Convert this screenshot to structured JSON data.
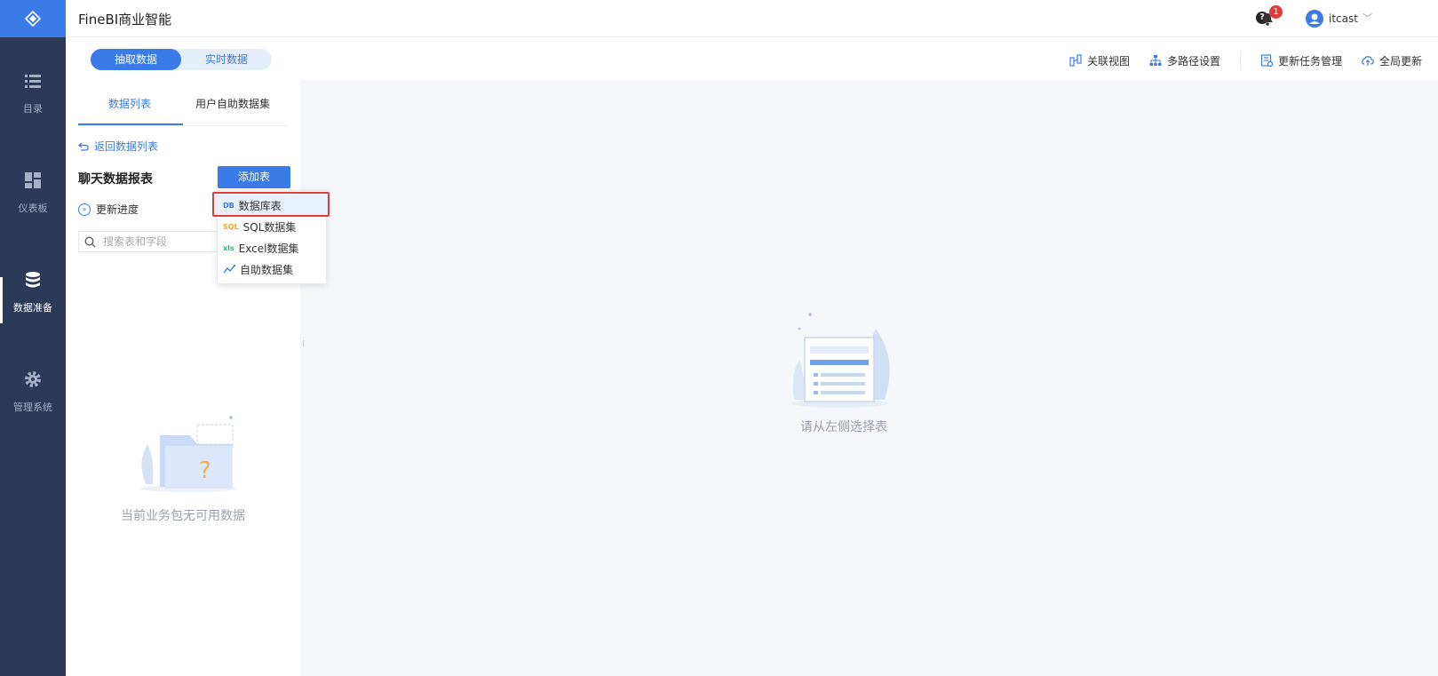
{
  "app": {
    "title": "FineBI商业智能"
  },
  "user": {
    "name": "itcast",
    "notifications": "1"
  },
  "nav": {
    "items": [
      {
        "label": "目录",
        "icon": "list-icon"
      },
      {
        "label": "仪表板",
        "icon": "dashboard-icon"
      },
      {
        "label": "数据准备",
        "icon": "database-icon",
        "active": true
      },
      {
        "label": "管理系统",
        "icon": "gear-icon"
      }
    ]
  },
  "mode": {
    "extract": "抽取数据",
    "realtime": "实时数据"
  },
  "toolbar": {
    "relation": "关联视图",
    "multipath": "多路径设置",
    "update_task": "更新任务管理",
    "global_update": "全局更新"
  },
  "panel": {
    "tabs": [
      "数据列表",
      "用户自助数据集"
    ],
    "back": "返回数据列表",
    "folder_title": "聊天数据报表",
    "add_table": "添加表",
    "progress": "更新进度",
    "search_placeholder": "搜索表和字段",
    "empty_text": "当前业务包无可用数据"
  },
  "dropdown": {
    "items": [
      {
        "tag": "DB",
        "label": "数据库表",
        "color": "#3a7be8"
      },
      {
        "tag": "SQL",
        "label": "SQL数据集",
        "color": "#f5a623"
      },
      {
        "tag": "xls",
        "label": "Excel数据集",
        "color": "#2fb36f"
      },
      {
        "tag": "",
        "label": "自助数据集",
        "color": "#3a7be8"
      }
    ]
  },
  "canvas": {
    "empty_text": "请从左侧选择表"
  },
  "colors": {
    "primary": "#3a7be8",
    "nav_bg": "#2a3a57",
    "highlight": "#e23b3b"
  }
}
